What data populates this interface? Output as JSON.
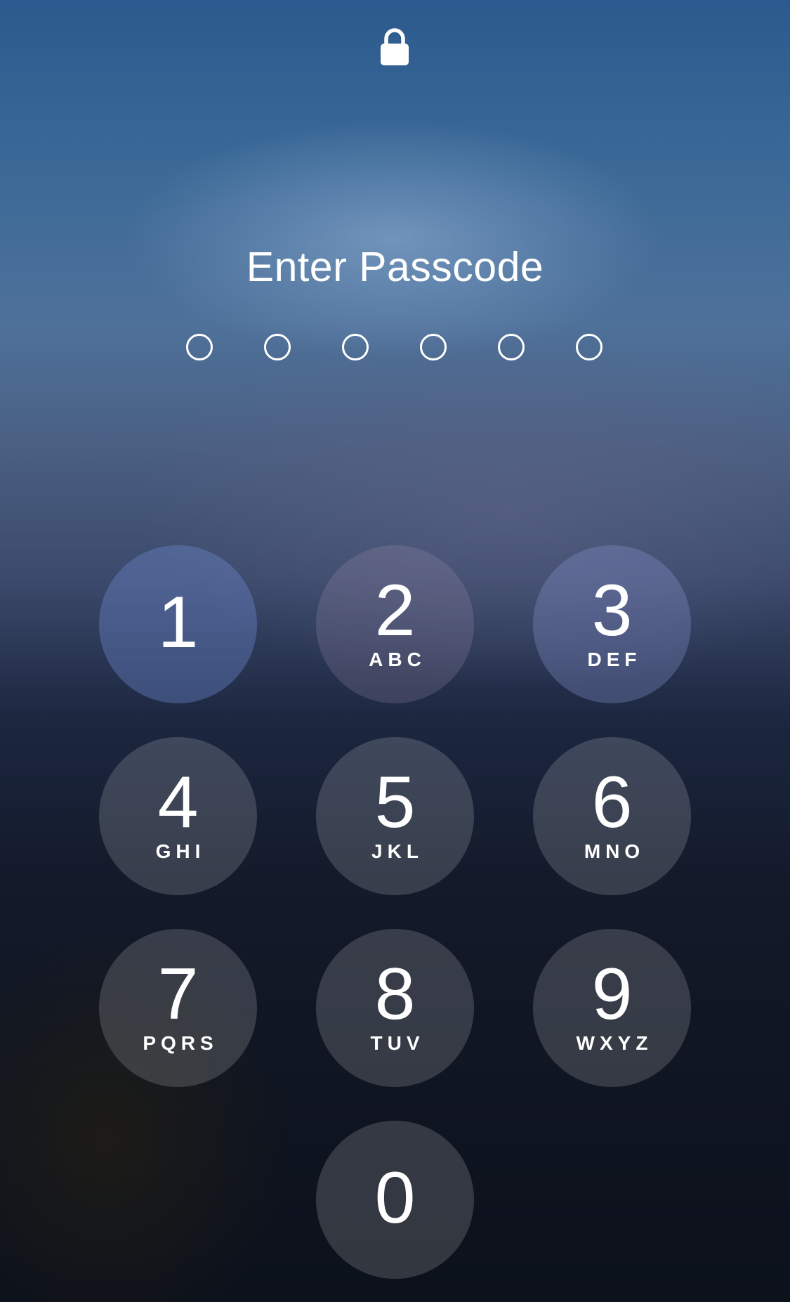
{
  "header": {
    "lock_icon": "lock-icon",
    "title": "Enter Passcode"
  },
  "passcode": {
    "length": 6,
    "entered": 0
  },
  "keypad": {
    "keys": [
      {
        "digit": "1",
        "letters": ""
      },
      {
        "digit": "2",
        "letters": "ABC"
      },
      {
        "digit": "3",
        "letters": "DEF"
      },
      {
        "digit": "4",
        "letters": "GHI"
      },
      {
        "digit": "5",
        "letters": "JKL"
      },
      {
        "digit": "6",
        "letters": "MNO"
      },
      {
        "digit": "7",
        "letters": "PQRS"
      },
      {
        "digit": "8",
        "letters": "TUV"
      },
      {
        "digit": "9",
        "letters": "WXYZ"
      },
      {
        "digit": "0",
        "letters": ""
      }
    ]
  },
  "colors": {
    "text": "#ffffff",
    "background_top": "#2c5a8e",
    "background_bottom": "#0c111b"
  }
}
